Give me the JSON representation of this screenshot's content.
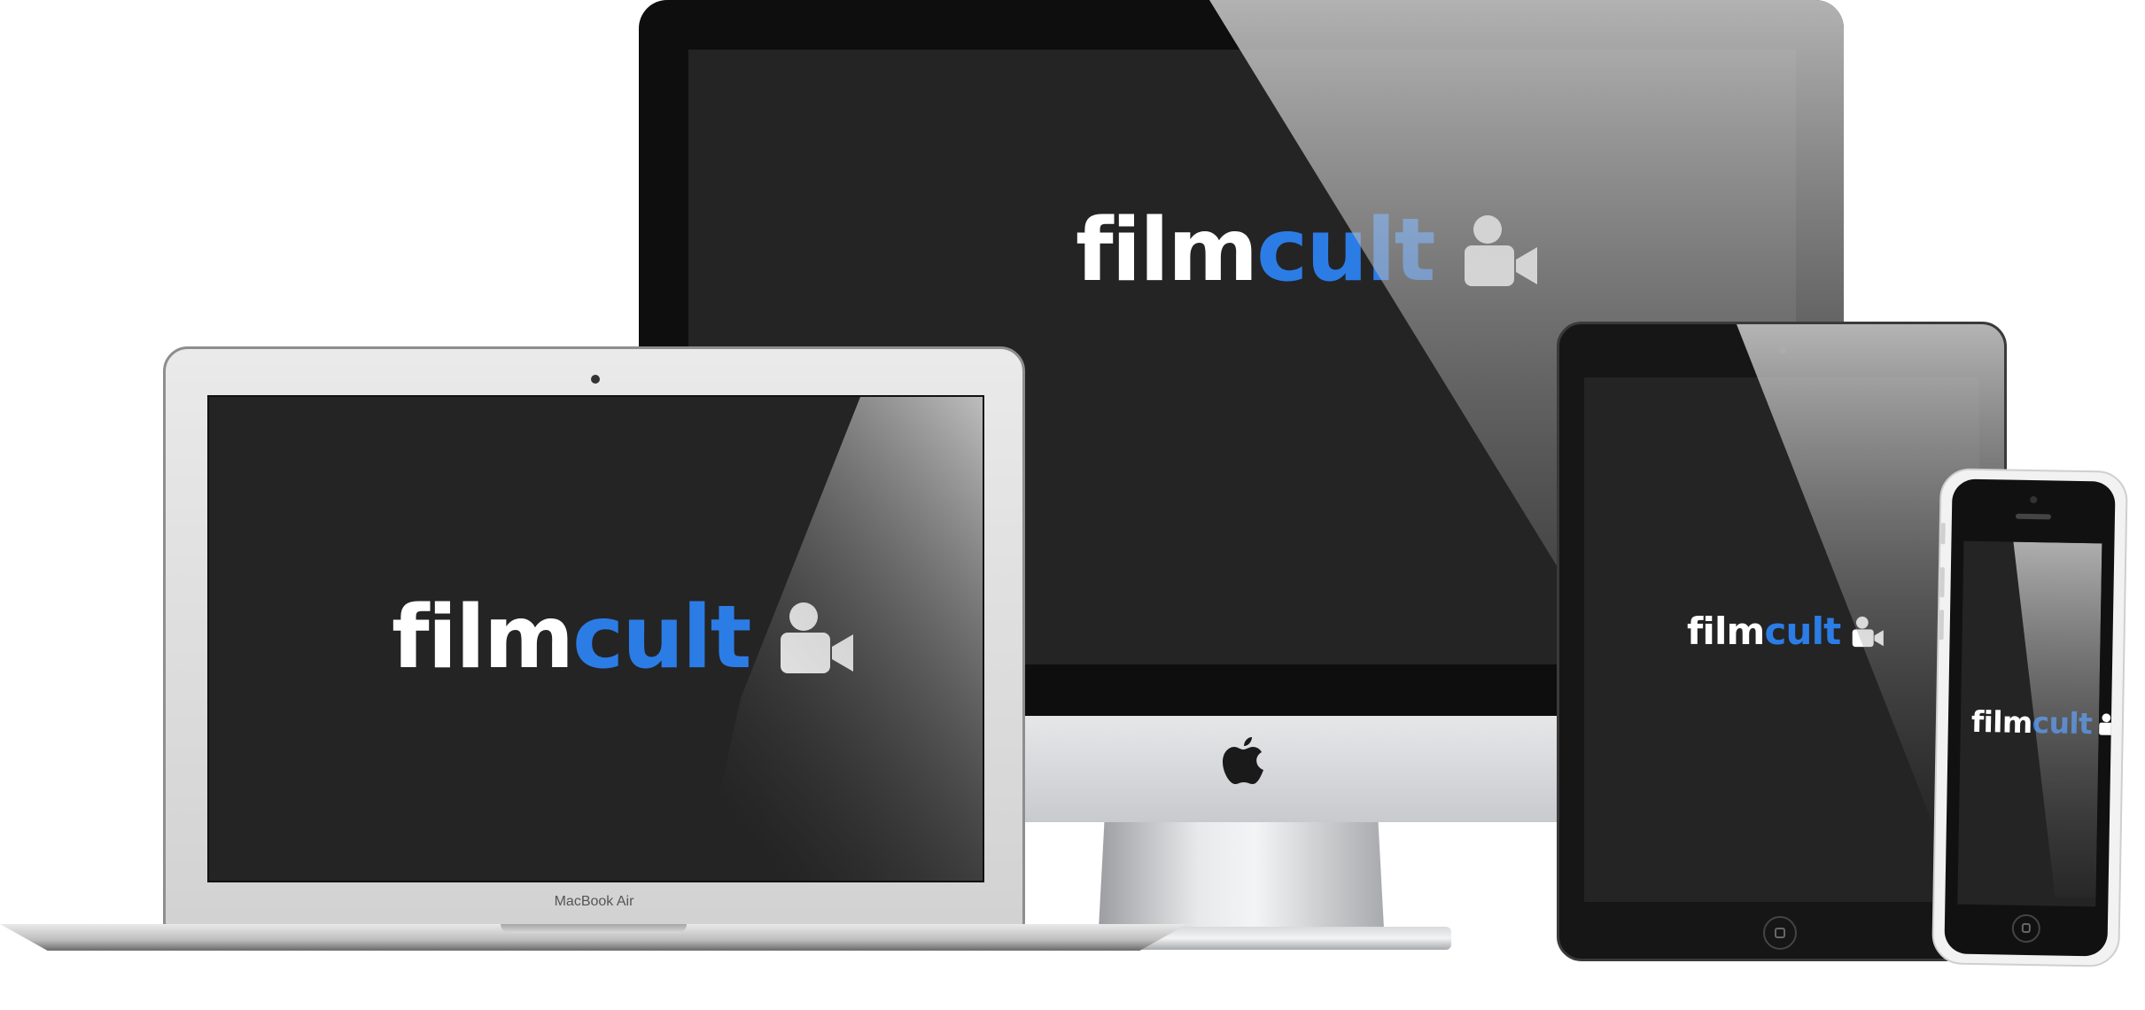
{
  "brand": {
    "word1": "film",
    "word2": "cult",
    "icon": "video-camera-icon",
    "accent_color": "#2c7ce6",
    "text_color": "#ffffff"
  },
  "devices": {
    "imac": {
      "icon": "apple-logo-icon"
    },
    "macbook": {
      "label": "MacBook Air"
    },
    "ipad": {},
    "iphone": {}
  },
  "colors": {
    "screen_bg": "#242424",
    "page_bg": "#ffffff"
  }
}
